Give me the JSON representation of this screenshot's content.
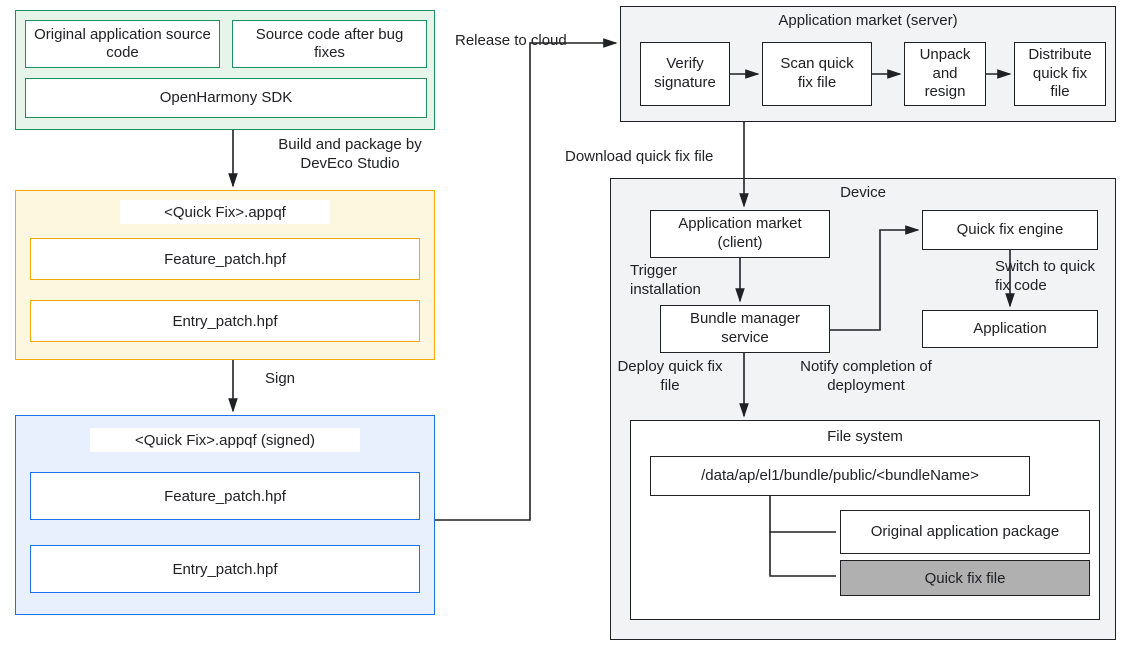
{
  "green": {
    "orig_src": "Original application\nsource code",
    "fixed_src": "Source code after\nbug fixes",
    "sdk": "OpenHarmony SDK"
  },
  "edge": {
    "build": "Build and package by\nDevEco Studio",
    "sign": "Sign",
    "release": "Release to cloud",
    "download": "Download quick fix file",
    "trigger": "Trigger\ninstallation",
    "deploy": "Deploy quick fix\nfile",
    "notify": "Notify completion of\ndeployment",
    "switch": "Switch to quick\nfix code"
  },
  "yellow": {
    "title": "<Quick Fix>.appqf",
    "feature": "Feature_patch.hpf",
    "entry": "Entry_patch.hpf"
  },
  "blue": {
    "title": "<Quick Fix>.appqf (signed)",
    "feature": "Feature_patch.hpf",
    "entry": "Entry_patch.hpf"
  },
  "market": {
    "title": "Application market (server)",
    "verify": "Verify\nsignature",
    "scan": "Scan quick fix\nfile",
    "unpack": "Unpack\nand\nresign",
    "distribute": "Distribute\nquick fix\nfile"
  },
  "device": {
    "title": "Device",
    "client": "Application market\n(client)",
    "bms": "Bundle manager\nservice",
    "engine": "Quick fix engine",
    "app": "Application"
  },
  "fs": {
    "title": "File system",
    "path": "/data/ap/el1/bundle/public/<bundleName>",
    "orig_pkg": "Original application\npackage",
    "qf_file": "Quick fix file"
  }
}
